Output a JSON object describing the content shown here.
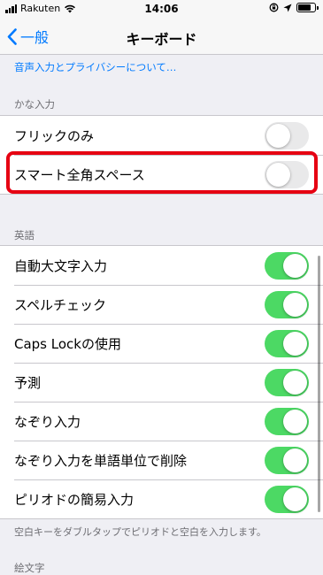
{
  "status_bar": {
    "carrier": "Rakuten",
    "time": "14:06"
  },
  "nav": {
    "back_label": "一般",
    "title": "キーボード"
  },
  "privacy_link": "音声入力とプライバシーについて…",
  "kana_section": {
    "header": "かな入力",
    "rows": [
      {
        "label": "フリックのみ",
        "on": false
      },
      {
        "label": "スマート全角スペース",
        "on": false
      }
    ]
  },
  "english_section": {
    "header": "英語",
    "rows": [
      {
        "label": "自動大文字入力",
        "on": true
      },
      {
        "label": "スペルチェック",
        "on": true
      },
      {
        "label": "Caps Lockの使用",
        "on": true
      },
      {
        "label": "予測",
        "on": true
      },
      {
        "label": "なぞり入力",
        "on": true
      },
      {
        "label": "なぞり入力を単語単位で削除",
        "on": true
      },
      {
        "label": "ピリオドの簡易入力",
        "on": true
      }
    ],
    "footer": "空白キーをダブルタップでピリオドと空白を入力します。"
  },
  "emoji_section": {
    "header": "絵文字"
  },
  "colors": {
    "accent": "#007aff",
    "toggle_on": "#4cd964",
    "highlight": "#e60012"
  }
}
